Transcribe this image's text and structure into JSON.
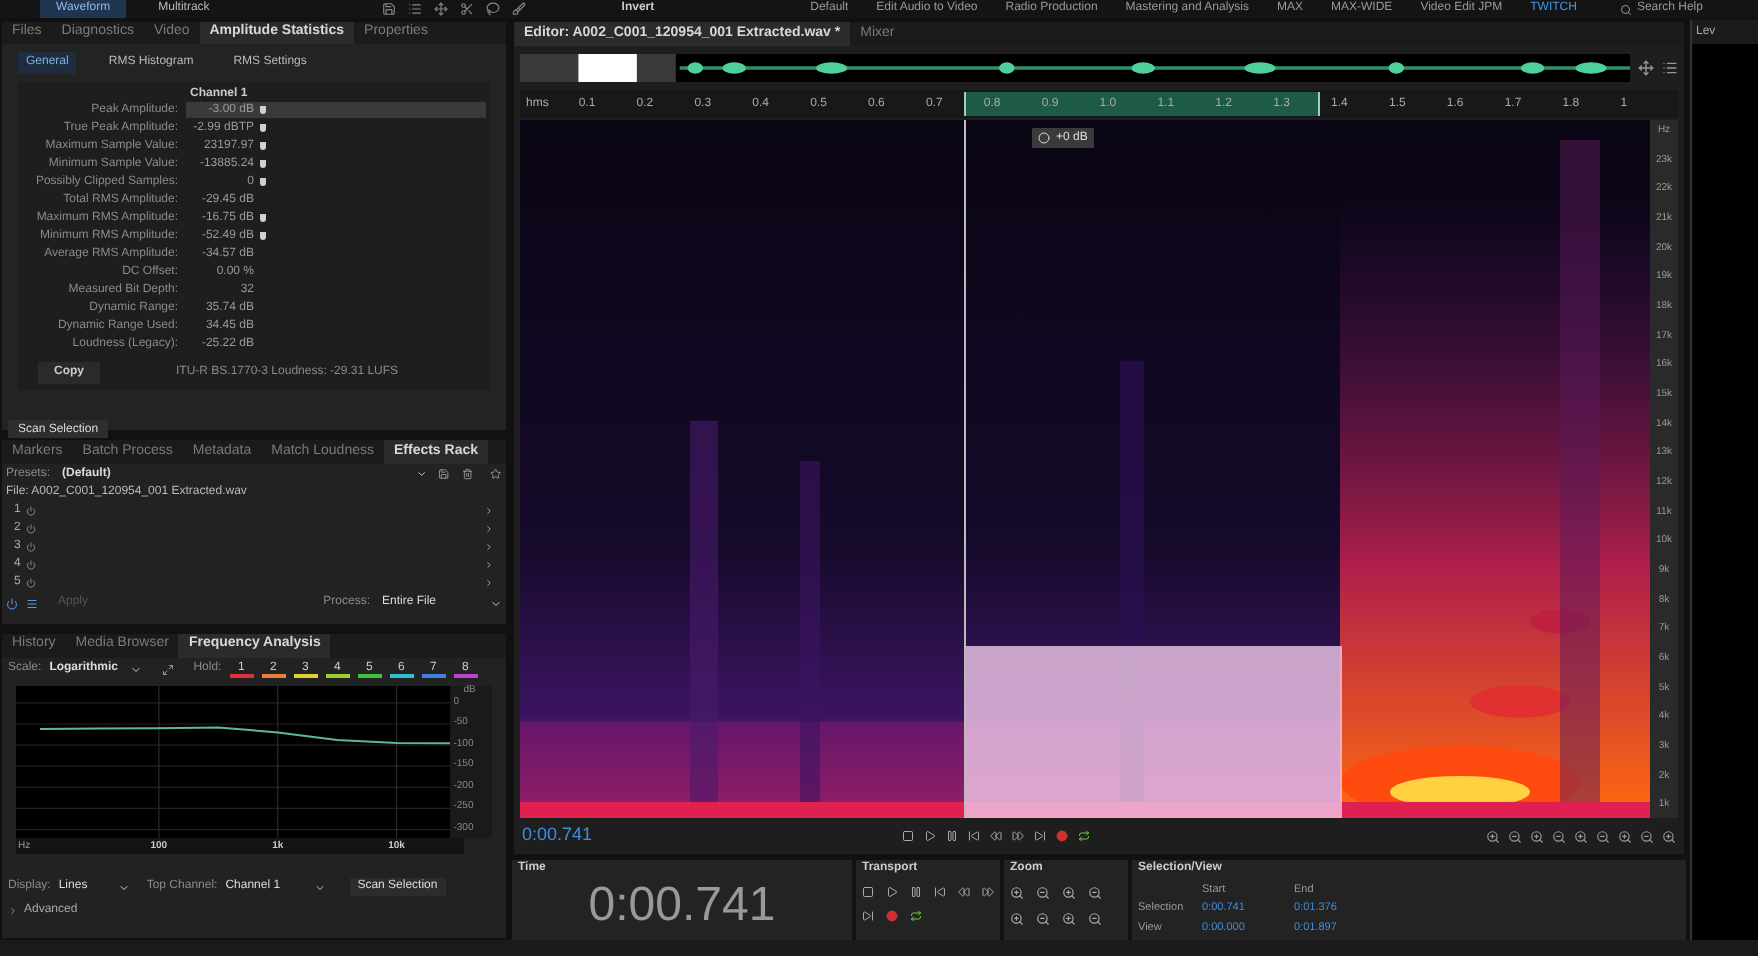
{
  "top_bar": {
    "modes": [
      {
        "label": "Waveform",
        "selected": true
      },
      {
        "label": "Multitrack",
        "selected": false
      }
    ],
    "menu_label": "Invert",
    "workspaces": [
      {
        "label": "Default",
        "selected": false
      },
      {
        "label": "Edit Audio to Video",
        "selected": false
      },
      {
        "label": "Radio Production",
        "selected": false
      },
      {
        "label": "Mastering and Analysis",
        "selected": false
      },
      {
        "label": "MAX",
        "selected": false
      },
      {
        "label": "MAX-WIDE",
        "selected": false
      },
      {
        "label": "Video Edit JPM",
        "selected": false
      },
      {
        "label": "TWITCH",
        "selected": true
      }
    ],
    "search": "Search Help"
  },
  "amplitude_panel": {
    "tabs": [
      {
        "label": "Files",
        "selected": false
      },
      {
        "label": "Diagnostics",
        "selected": false
      },
      {
        "label": "Video",
        "selected": false
      },
      {
        "label": "Amplitude Statistics",
        "selected": true
      },
      {
        "label": "Properties",
        "selected": false
      }
    ],
    "subtabs": [
      {
        "label": "General",
        "selected": true
      },
      {
        "label": "RMS Histogram",
        "selected": false
      },
      {
        "label": "RMS Settings",
        "selected": false
      }
    ],
    "channel": "Channel 1",
    "rows": [
      {
        "label": "Peak Amplitude:",
        "value": "-3.00 dB",
        "marker": true,
        "selected": true
      },
      {
        "label": "True Peak Amplitude:",
        "value": "-2.99 dBTP",
        "marker": true,
        "selected": false
      },
      {
        "label": "Maximum Sample Value:",
        "value": "23197.97",
        "marker": true,
        "selected": false
      },
      {
        "label": "Minimum Sample Value:",
        "value": "-13885.24",
        "marker": true,
        "selected": false
      },
      {
        "label": "Possibly Clipped Samples:",
        "value": "0",
        "marker": true,
        "selected": false
      },
      {
        "label": "Total RMS Amplitude:",
        "value": "-29.45 dB",
        "marker": false,
        "selected": false
      },
      {
        "label": "Maximum RMS Amplitude:",
        "value": "-16.75 dB",
        "marker": true,
        "selected": false
      },
      {
        "label": "Minimum RMS Amplitude:",
        "value": "-52.49 dB",
        "marker": true,
        "selected": false
      },
      {
        "label": "Average RMS Amplitude:",
        "value": "-34.57 dB",
        "marker": false,
        "selected": false
      },
      {
        "label": "DC Offset:",
        "value": "0.00 %",
        "marker": false,
        "selected": false
      },
      {
        "label": "Measured Bit Depth:",
        "value": "32",
        "marker": false,
        "selected": false
      },
      {
        "label": "Dynamic Range:",
        "value": "35.74 dB",
        "marker": false,
        "selected": false
      },
      {
        "label": "Dynamic Range Used:",
        "value": "34.45 dB",
        "marker": false,
        "selected": false
      },
      {
        "label": "Loudness (Legacy):",
        "value": "-25.22 dB",
        "marker": false,
        "selected": false
      }
    ],
    "copy": "Copy",
    "loudness": "ITU-R BS.1770-3 Loudness: -29.31 LUFS",
    "scan": "Scan Selection"
  },
  "effects_panel": {
    "tabs": [
      {
        "label": "Markers",
        "selected": false
      },
      {
        "label": "Batch Process",
        "selected": false
      },
      {
        "label": "Metadata",
        "selected": false
      },
      {
        "label": "Match Loudness",
        "selected": false
      },
      {
        "label": "Effects Rack",
        "selected": true
      }
    ],
    "presets_label": "Presets:",
    "preset": "(Default)",
    "file": "File: A002_C001_120954_001 Extracted.wav",
    "slots": [
      "1",
      "2",
      "3",
      "4",
      "5"
    ],
    "apply": {
      "label": "Apply",
      "disabled": true
    },
    "process_label": "Process:",
    "process": "Entire File"
  },
  "frequency_panel": {
    "tabs": [
      {
        "label": "History",
        "selected": false
      },
      {
        "label": "Media Browser",
        "selected": false
      },
      {
        "label": "Frequency Analysis",
        "selected": true
      }
    ],
    "scale_label": "Scale:",
    "scale": "Logarithmic",
    "hold_label": "Hold:",
    "holds": [
      {
        "label": "1",
        "color": "#e0303a"
      },
      {
        "label": "2",
        "color": "#e8803a"
      },
      {
        "label": "3",
        "color": "#e0d030"
      },
      {
        "label": "4",
        "color": "#9ad030"
      },
      {
        "label": "5",
        "color": "#40c040"
      },
      {
        "label": "6",
        "color": "#30c0d0"
      },
      {
        "label": "7",
        "color": "#4080e0"
      },
      {
        "label": "8",
        "color": "#c040d0"
      }
    ],
    "chart_data": {
      "type": "line",
      "xlabel": "Hz",
      "ylabel": "dB",
      "categories": [
        null,
        null,
        "100",
        null,
        "1k",
        null,
        "10k",
        null
      ],
      "series": [
        {
          "color": "#5fb89a",
          "values": [
            -62,
            -61,
            -60,
            -58,
            -70,
            -88,
            -95,
            -96
          ]
        }
      ],
      "grid": true,
      "ylim": [
        -320,
        40
      ],
      "yticks": [
        0,
        -50,
        -100,
        -150,
        -200,
        -250,
        -300
      ]
    },
    "display_label": "Display:",
    "display": "Lines",
    "top_channel_label": "Top Channel:",
    "top_channel": "Channel 1",
    "scan": "Scan Selection",
    "advanced": {
      "label": "Advanced",
      "expanded": false
    }
  },
  "editor": {
    "tabs": [
      {
        "label": "Editor: A002_C001_120954_001 Extracted.wav *",
        "selected": true
      },
      {
        "label": "Mixer",
        "selected": false
      }
    ],
    "ruler_unit": "hms",
    "ruler": [
      "0.1",
      "0.2",
      "0.3",
      "0.4",
      "0.5",
      "0.6",
      "0.7",
      "0.8",
      "0.9",
      "1.0",
      "1.1",
      "1.2",
      "1.3",
      "1.4",
      "1.5",
      "1.6",
      "1.7",
      "1.8",
      "1"
    ],
    "hud_gain": "+0 dB",
    "freq_unit": "Hz",
    "freqs": [
      "23k",
      "22k",
      "21k",
      "20k",
      "19k",
      "18k",
      "17k",
      "16k",
      "15k",
      "14k",
      "13k",
      "12k",
      "11k",
      "10k",
      "9k",
      "8k",
      "7k",
      "6k",
      "5k",
      "4k",
      "3k",
      "2k",
      "1k"
    ],
    "current_time": "0:00.741"
  },
  "bottom": {
    "time_title": "Time",
    "time": "0:00.741",
    "transport_title": "Transport",
    "zoom_title": "Zoom",
    "selection_title": "Selection/View",
    "columns": [
      "Start",
      "End"
    ],
    "rows": [
      {
        "label": "Selection",
        "values": [
          "0:00.741",
          "0:01.376"
        ]
      },
      {
        "label": "View",
        "values": [
          "0:00.000",
          "0:01.897"
        ]
      }
    ]
  },
  "levels_title": "Lev"
}
